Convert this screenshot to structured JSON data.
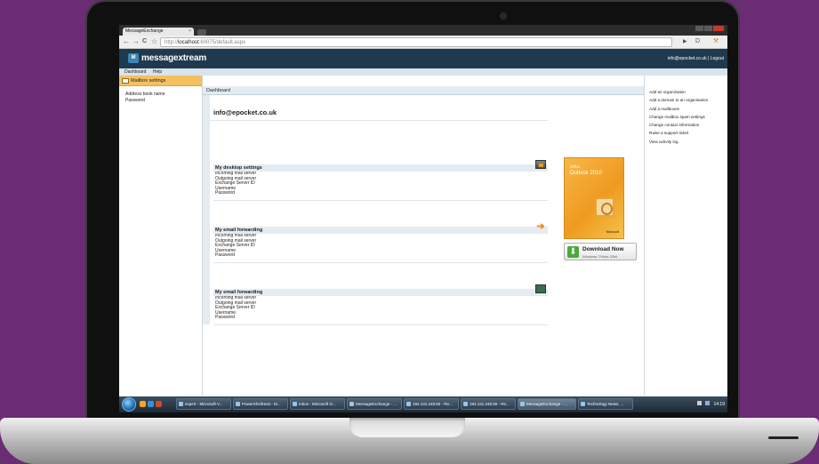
{
  "browser": {
    "tab_title": "MessageExchange",
    "tab_close": "×",
    "url_prefix": "http://",
    "url_host": "localhost",
    "url_path": ":60075/default.aspx",
    "back": "←",
    "forward": "→",
    "reload": "C",
    "star": "☆",
    "play": "▶",
    "page_menu": "D",
    "wrench": "⚒"
  },
  "header": {
    "logo_mark": "M",
    "logo_text": "messagextream",
    "user_email": "info@epocket.co.uk",
    "separator": " | ",
    "logout": "Logout"
  },
  "menubar": [
    "Dashboard",
    "Help"
  ],
  "left": {
    "header": "Mailbox settings",
    "links": [
      "Address book name",
      "Password"
    ]
  },
  "main": {
    "breadcrumb": "Dashboard",
    "account": "info@epocket.co.uk",
    "sections": [
      {
        "title": "My desktop settings",
        "icon": "monitor-settings-icon",
        "lines": [
          "Incoming mail server",
          "Outgoing mail server",
          "Exchange Server ID",
          "Username",
          "Password"
        ]
      },
      {
        "title": "My email forwarding",
        "icon": "forward-arrow-icon",
        "lines": [
          "Incoming mail server",
          "Outgoing mail server",
          "Exchange Server ID",
          "Username",
          "Password"
        ]
      },
      {
        "title": "My email forwarding",
        "icon": "server-icon",
        "lines": [
          "Incoming mail server",
          "Outgoing mail server",
          "Exchange Server ID",
          "Username",
          "Password"
        ]
      }
    ]
  },
  "promo": {
    "brand": "Office",
    "product": "Outlook 2010",
    "maker": "Microsoft",
    "download_title": "Download Now",
    "download_sub": "Windows 7/Vista 32bit"
  },
  "right": {
    "links": [
      "Add an organization",
      "Add a domain to an organisation",
      "Add a mailboxes",
      "Change mailbox spam settings",
      "Change contact information",
      "Raise a support ticket",
      "View activity log"
    ]
  },
  "taskbar": {
    "tasks": [
      "expert - Microsoft V...",
      "PowerShellHost - M...",
      "Inbox - Microsoft O...",
      "MessageExchange - ...",
      "194.131.248.50 - Re...",
      "194.131.248.55 - Re...",
      "MessageExchange - ...",
      "Technology News, ..."
    ],
    "clock": "14:19"
  },
  "colors": {
    "background": "#6a2c73",
    "app_header": "#1f3a4f",
    "section_bar": "#e3ecf2",
    "left_header": "#f5c160"
  }
}
